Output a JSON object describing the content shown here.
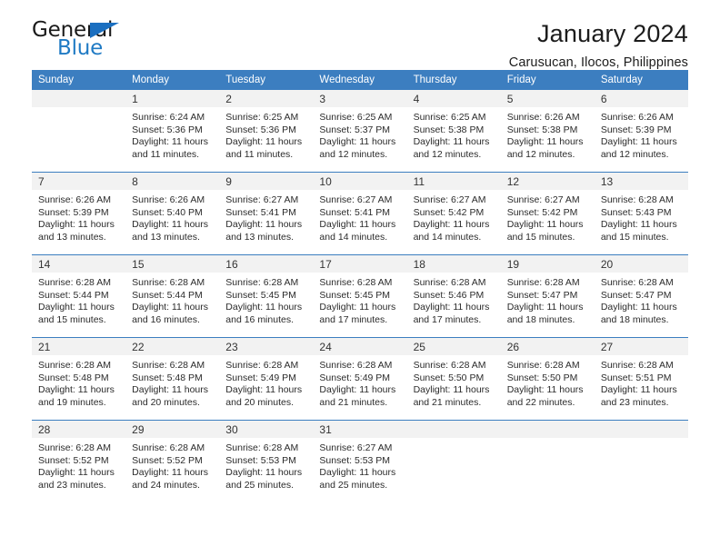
{
  "brand": {
    "name_part1": "General",
    "name_part2": "Blue",
    "triangle_color": "#1b6fc0",
    "blue_color": "#1f7ac4"
  },
  "header": {
    "title": "January 2024",
    "subtitle": "Carusucan, Ilocos, Philippines"
  },
  "theme": {
    "header_bg": "#3c7ec0",
    "daynum_bg": "#f2f2f2",
    "grid_line": "#3c7ec0"
  },
  "weekday_headers": [
    "Sunday",
    "Monday",
    "Tuesday",
    "Wednesday",
    "Thursday",
    "Friday",
    "Saturday"
  ],
  "weeks": [
    [
      {
        "day": "",
        "sunrise": "",
        "sunset": "",
        "daylight_line1": "",
        "daylight_line2": ""
      },
      {
        "day": "1",
        "sunrise": "Sunrise: 6:24 AM",
        "sunset": "Sunset: 5:36 PM",
        "daylight_line1": "Daylight: 11 hours",
        "daylight_line2": "and 11 minutes."
      },
      {
        "day": "2",
        "sunrise": "Sunrise: 6:25 AM",
        "sunset": "Sunset: 5:36 PM",
        "daylight_line1": "Daylight: 11 hours",
        "daylight_line2": "and 11 minutes."
      },
      {
        "day": "3",
        "sunrise": "Sunrise: 6:25 AM",
        "sunset": "Sunset: 5:37 PM",
        "daylight_line1": "Daylight: 11 hours",
        "daylight_line2": "and 12 minutes."
      },
      {
        "day": "4",
        "sunrise": "Sunrise: 6:25 AM",
        "sunset": "Sunset: 5:38 PM",
        "daylight_line1": "Daylight: 11 hours",
        "daylight_line2": "and 12 minutes."
      },
      {
        "day": "5",
        "sunrise": "Sunrise: 6:26 AM",
        "sunset": "Sunset: 5:38 PM",
        "daylight_line1": "Daylight: 11 hours",
        "daylight_line2": "and 12 minutes."
      },
      {
        "day": "6",
        "sunrise": "Sunrise: 6:26 AM",
        "sunset": "Sunset: 5:39 PM",
        "daylight_line1": "Daylight: 11 hours",
        "daylight_line2": "and 12 minutes."
      }
    ],
    [
      {
        "day": "7",
        "sunrise": "Sunrise: 6:26 AM",
        "sunset": "Sunset: 5:39 PM",
        "daylight_line1": "Daylight: 11 hours",
        "daylight_line2": "and 13 minutes."
      },
      {
        "day": "8",
        "sunrise": "Sunrise: 6:26 AM",
        "sunset": "Sunset: 5:40 PM",
        "daylight_line1": "Daylight: 11 hours",
        "daylight_line2": "and 13 minutes."
      },
      {
        "day": "9",
        "sunrise": "Sunrise: 6:27 AM",
        "sunset": "Sunset: 5:41 PM",
        "daylight_line1": "Daylight: 11 hours",
        "daylight_line2": "and 13 minutes."
      },
      {
        "day": "10",
        "sunrise": "Sunrise: 6:27 AM",
        "sunset": "Sunset: 5:41 PM",
        "daylight_line1": "Daylight: 11 hours",
        "daylight_line2": "and 14 minutes."
      },
      {
        "day": "11",
        "sunrise": "Sunrise: 6:27 AM",
        "sunset": "Sunset: 5:42 PM",
        "daylight_line1": "Daylight: 11 hours",
        "daylight_line2": "and 14 minutes."
      },
      {
        "day": "12",
        "sunrise": "Sunrise: 6:27 AM",
        "sunset": "Sunset: 5:42 PM",
        "daylight_line1": "Daylight: 11 hours",
        "daylight_line2": "and 15 minutes."
      },
      {
        "day": "13",
        "sunrise": "Sunrise: 6:28 AM",
        "sunset": "Sunset: 5:43 PM",
        "daylight_line1": "Daylight: 11 hours",
        "daylight_line2": "and 15 minutes."
      }
    ],
    [
      {
        "day": "14",
        "sunrise": "Sunrise: 6:28 AM",
        "sunset": "Sunset: 5:44 PM",
        "daylight_line1": "Daylight: 11 hours",
        "daylight_line2": "and 15 minutes."
      },
      {
        "day": "15",
        "sunrise": "Sunrise: 6:28 AM",
        "sunset": "Sunset: 5:44 PM",
        "daylight_line1": "Daylight: 11 hours",
        "daylight_line2": "and 16 minutes."
      },
      {
        "day": "16",
        "sunrise": "Sunrise: 6:28 AM",
        "sunset": "Sunset: 5:45 PM",
        "daylight_line1": "Daylight: 11 hours",
        "daylight_line2": "and 16 minutes."
      },
      {
        "day": "17",
        "sunrise": "Sunrise: 6:28 AM",
        "sunset": "Sunset: 5:45 PM",
        "daylight_line1": "Daylight: 11 hours",
        "daylight_line2": "and 17 minutes."
      },
      {
        "day": "18",
        "sunrise": "Sunrise: 6:28 AM",
        "sunset": "Sunset: 5:46 PM",
        "daylight_line1": "Daylight: 11 hours",
        "daylight_line2": "and 17 minutes."
      },
      {
        "day": "19",
        "sunrise": "Sunrise: 6:28 AM",
        "sunset": "Sunset: 5:47 PM",
        "daylight_line1": "Daylight: 11 hours",
        "daylight_line2": "and 18 minutes."
      },
      {
        "day": "20",
        "sunrise": "Sunrise: 6:28 AM",
        "sunset": "Sunset: 5:47 PM",
        "daylight_line1": "Daylight: 11 hours",
        "daylight_line2": "and 18 minutes."
      }
    ],
    [
      {
        "day": "21",
        "sunrise": "Sunrise: 6:28 AM",
        "sunset": "Sunset: 5:48 PM",
        "daylight_line1": "Daylight: 11 hours",
        "daylight_line2": "and 19 minutes."
      },
      {
        "day": "22",
        "sunrise": "Sunrise: 6:28 AM",
        "sunset": "Sunset: 5:48 PM",
        "daylight_line1": "Daylight: 11 hours",
        "daylight_line2": "and 20 minutes."
      },
      {
        "day": "23",
        "sunrise": "Sunrise: 6:28 AM",
        "sunset": "Sunset: 5:49 PM",
        "daylight_line1": "Daylight: 11 hours",
        "daylight_line2": "and 20 minutes."
      },
      {
        "day": "24",
        "sunrise": "Sunrise: 6:28 AM",
        "sunset": "Sunset: 5:49 PM",
        "daylight_line1": "Daylight: 11 hours",
        "daylight_line2": "and 21 minutes."
      },
      {
        "day": "25",
        "sunrise": "Sunrise: 6:28 AM",
        "sunset": "Sunset: 5:50 PM",
        "daylight_line1": "Daylight: 11 hours",
        "daylight_line2": "and 21 minutes."
      },
      {
        "day": "26",
        "sunrise": "Sunrise: 6:28 AM",
        "sunset": "Sunset: 5:50 PM",
        "daylight_line1": "Daylight: 11 hours",
        "daylight_line2": "and 22 minutes."
      },
      {
        "day": "27",
        "sunrise": "Sunrise: 6:28 AM",
        "sunset": "Sunset: 5:51 PM",
        "daylight_line1": "Daylight: 11 hours",
        "daylight_line2": "and 23 minutes."
      }
    ],
    [
      {
        "day": "28",
        "sunrise": "Sunrise: 6:28 AM",
        "sunset": "Sunset: 5:52 PM",
        "daylight_line1": "Daylight: 11 hours",
        "daylight_line2": "and 23 minutes."
      },
      {
        "day": "29",
        "sunrise": "Sunrise: 6:28 AM",
        "sunset": "Sunset: 5:52 PM",
        "daylight_line1": "Daylight: 11 hours",
        "daylight_line2": "and 24 minutes."
      },
      {
        "day": "30",
        "sunrise": "Sunrise: 6:28 AM",
        "sunset": "Sunset: 5:53 PM",
        "daylight_line1": "Daylight: 11 hours",
        "daylight_line2": "and 25 minutes."
      },
      {
        "day": "31",
        "sunrise": "Sunrise: 6:27 AM",
        "sunset": "Sunset: 5:53 PM",
        "daylight_line1": "Daylight: 11 hours",
        "daylight_line2": "and 25 minutes."
      },
      {
        "day": "",
        "sunrise": "",
        "sunset": "",
        "daylight_line1": "",
        "daylight_line2": ""
      },
      {
        "day": "",
        "sunrise": "",
        "sunset": "",
        "daylight_line1": "",
        "daylight_line2": ""
      },
      {
        "day": "",
        "sunrise": "",
        "sunset": "",
        "daylight_line1": "",
        "daylight_line2": ""
      }
    ]
  ]
}
